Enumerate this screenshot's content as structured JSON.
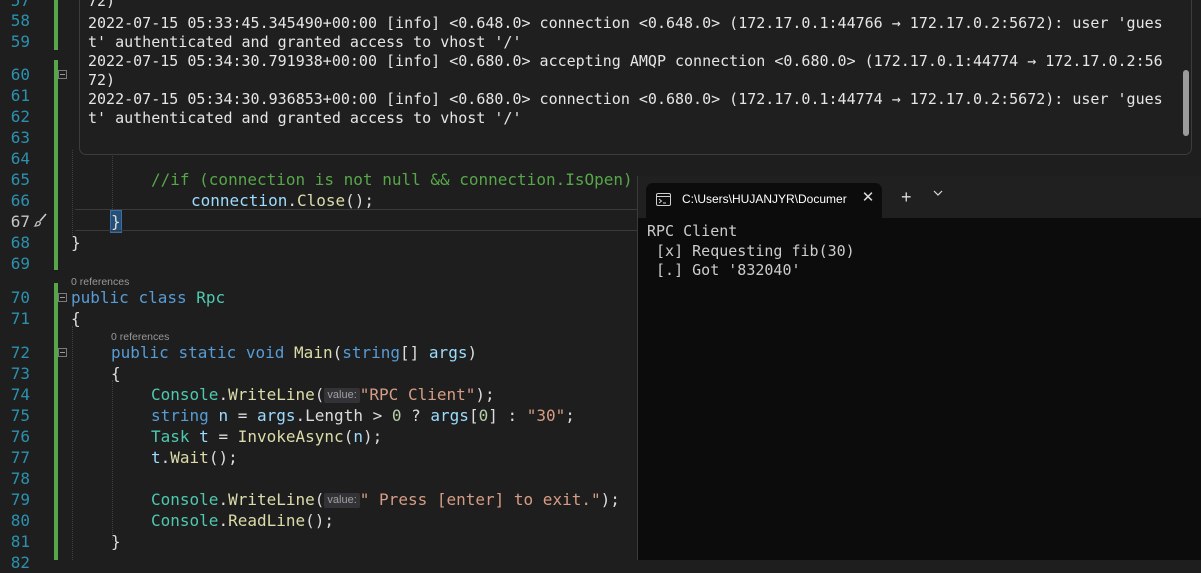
{
  "editor": {
    "line_numbers": [
      "57",
      "58",
      "59",
      "60",
      "61",
      "62",
      "63",
      "64",
      "65",
      "66",
      "67",
      "68",
      "69",
      "70",
      "71",
      "72",
      "73",
      "74",
      "75",
      "76",
      "77",
      "78",
      "79",
      "80",
      "81",
      "82"
    ],
    "codelens_class": "0 references",
    "codelens_main": "0 references",
    "comment_line": "//if (connection is not null && connection.IsOpen)",
    "close_call": {
      "obj": "connection",
      "method": "Close",
      "tail": "();"
    },
    "class_decl": {
      "kw1": "public",
      "kw2": "class",
      "name": "Rpc"
    },
    "main_decl": {
      "kw1": "public",
      "kw2": "static",
      "kw3": "void",
      "name": "Main",
      "ptype": "string",
      "pname": "args"
    },
    "writeline1": {
      "cls": "Console",
      "method": "WriteLine",
      "hint": "value:",
      "arg": "\"RPC Client\""
    },
    "string_decl": {
      "type": "string",
      "var": "n",
      "args": "args",
      "prop": "Length",
      "zero": "0",
      "idx": "0",
      "def": "\"30\""
    },
    "task_decl": {
      "type": "Task",
      "var": "t",
      "method": "InvokeAsync",
      "arg": "n"
    },
    "wait_call": {
      "obj": "t",
      "method": "Wait"
    },
    "writeline2": {
      "cls": "Console",
      "method": "WriteLine",
      "hint": "value:",
      "arg": "\" Press [enter] to exit.\""
    },
    "readline": {
      "cls": "Console",
      "method": "ReadLine"
    }
  },
  "log_popup": {
    "lines": [
      "72)",
      "2022-07-15 05:33:45.345490+00:00 [info] <0.648.0> connection <0.648.0> (172.17.0.1:44766 → 172.17.0.2:5672): user 'gues",
      "t' authenticated and granted access to vhost '/'",
      "2022-07-15 05:34:30.791938+00:00 [info] <0.680.0> accepting AMQP connection <0.680.0> (172.17.0.1:44774 → 172.17.0.2:56",
      "72)",
      "2022-07-15 05:34:30.936853+00:00 [info] <0.680.0> connection <0.680.0> (172.17.0.1:44774 → 172.17.0.2:5672): user 'gues",
      "t' authenticated and granted access to vhost '/'"
    ]
  },
  "terminal": {
    "tab_title": "C:\\Users\\HUJANJYR\\Documer",
    "new_tab": "+",
    "output": [
      "RPC Client",
      " [x] Requesting fib(30)",
      " [.] Got '832040'"
    ]
  },
  "icons": [
    "terminal-tab-icon",
    "close-icon",
    "plus-icon",
    "chevron-down-icon",
    "fold-icon",
    "brush-icon"
  ],
  "colors": {
    "keyword": "#569cd6",
    "type": "#4ec9b0",
    "method": "#dcdcaa",
    "string": "#d69d85",
    "comment": "#57a64a",
    "line_number": "#2b91af"
  }
}
